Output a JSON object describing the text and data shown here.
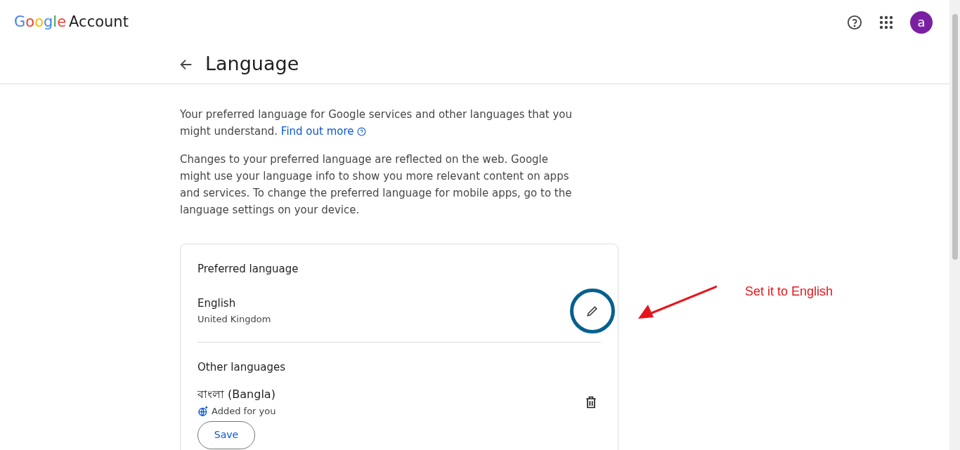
{
  "header": {
    "logo": "Google",
    "product": "Account",
    "avatar": "a"
  },
  "page": {
    "title": "Language"
  },
  "intro": {
    "text": "Your preferred language for Google services and other languages that you might understand.",
    "link": "Find out more"
  },
  "note": "Changes to your preferred language are reflected on the web. Google might use your language info to show you more relevant content on apps and services. To change the preferred language for mobile apps, go to the language settings on your device.",
  "preferred": {
    "heading": "Preferred language",
    "language": "English",
    "region": "United Kingdom"
  },
  "other": {
    "heading": "Other languages",
    "items": [
      {
        "language": "বাংলা (Bangla)",
        "note": "Added for you"
      }
    ],
    "button": "Save"
  },
  "annotation": {
    "text": "Set it to English"
  }
}
